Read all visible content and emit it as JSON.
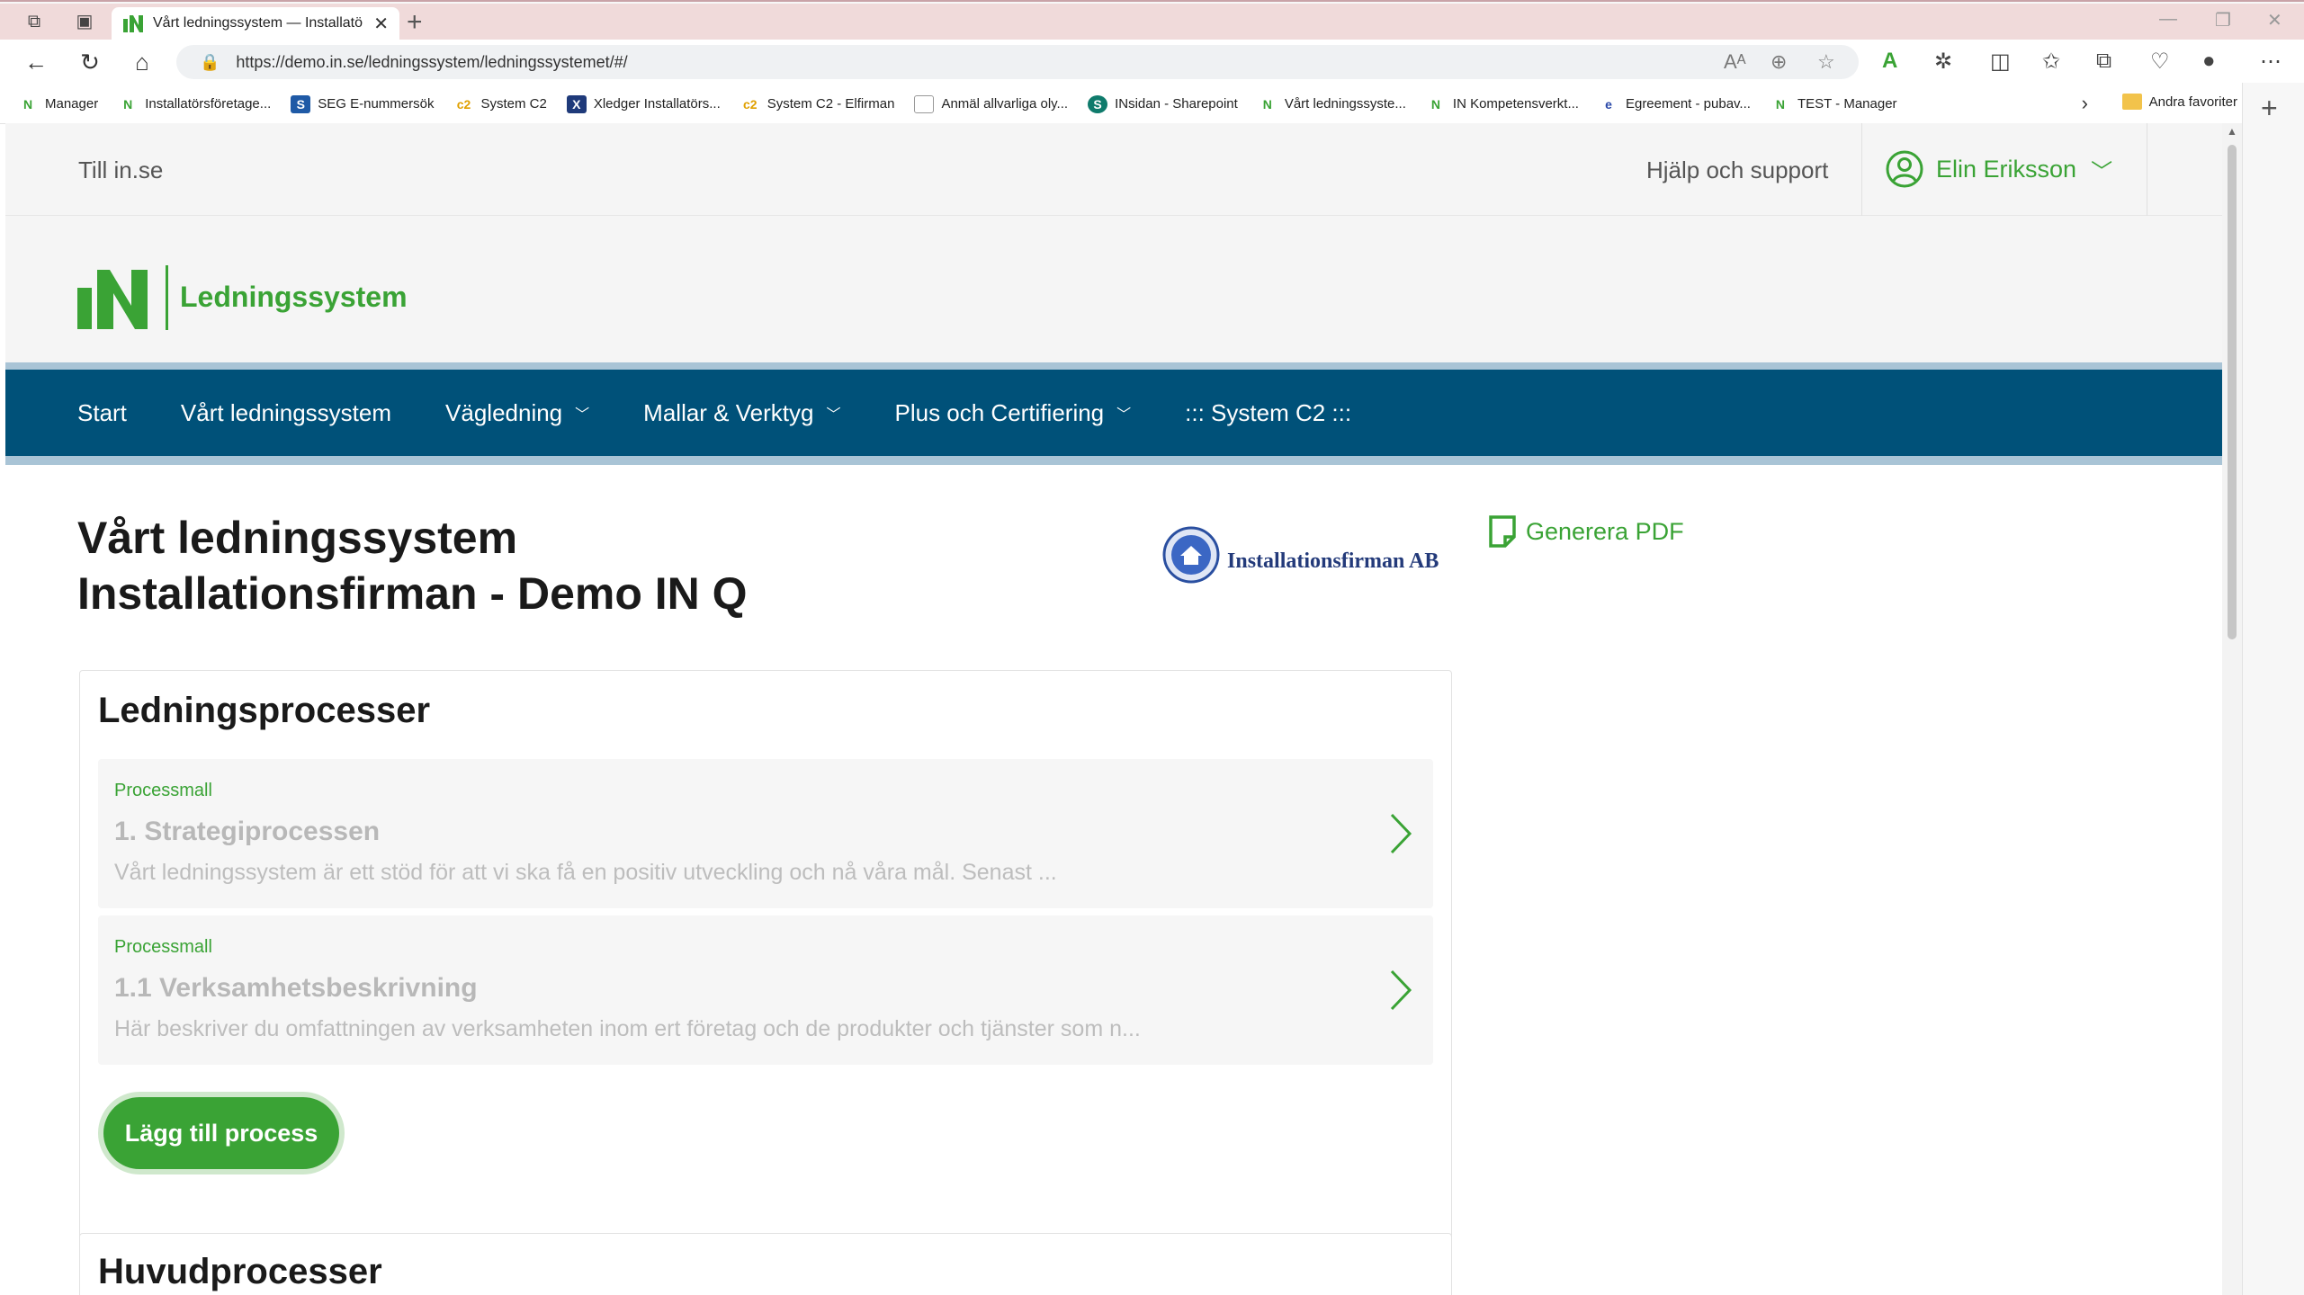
{
  "browser": {
    "tab_title": "Vårt ledningssystem — Installatö",
    "url": "https://demo.in.se/ledningssystem/ledningssystemet/#/",
    "favorites": [
      {
        "label": "Manager",
        "icon": "in"
      },
      {
        "label": "Installatörsföretage...",
        "icon": "in"
      },
      {
        "label": "SEG E-nummersök",
        "icon": "seg"
      },
      {
        "label": "System C2",
        "icon": "c2"
      },
      {
        "label": "Xledger  Installatörs...",
        "icon": "xl"
      },
      {
        "label": "System C2 - Elfirman",
        "icon": "c2"
      },
      {
        "label": "Anmäl allvarliga oly...",
        "icon": "doc"
      },
      {
        "label": "INsidan - Sharepoint",
        "icon": "sp"
      },
      {
        "label": "Vårt ledningssyste...",
        "icon": "in"
      },
      {
        "label": "IN Kompetensverkt...",
        "icon": "in"
      },
      {
        "label": "Egreement - pubav...",
        "icon": "eg"
      },
      {
        "label": "TEST - Manager",
        "icon": "in"
      }
    ],
    "other_favorites": "Andra favoriter"
  },
  "topbar": {
    "back_link": "Till in.se",
    "help": "Hjälp och support",
    "user_name": "Elin Eriksson"
  },
  "brand": {
    "name": "Ledningssystem",
    "color": "#3aa335"
  },
  "nav": {
    "items": [
      {
        "label": "Start",
        "dropdown": false
      },
      {
        "label": "Vårt ledningssystem",
        "dropdown": false
      },
      {
        "label": "Vägledning",
        "dropdown": true
      },
      {
        "label": "Mallar & Verktyg",
        "dropdown": true
      },
      {
        "label": "Plus och Certifiering",
        "dropdown": true
      },
      {
        "label": "::: System C2 :::",
        "dropdown": false
      }
    ],
    "background": "#005179"
  },
  "main": {
    "title_line1": "Vårt ledningssystem",
    "title_line2": "Installationsfirman - Demo IN Q",
    "company_name": "Installationsfirman AB",
    "generate_pdf": "Generera PDF"
  },
  "sections": [
    {
      "title": "Ledningsprocesser",
      "processes": [
        {
          "kind": "Processmall",
          "name": "1. Strategiprocessen",
          "desc": "Vårt ledningssystem är ett stöd för att vi ska få en positiv utveckling och nå våra mål. Senast ..."
        },
        {
          "kind": "Processmall",
          "name": "1.1 Verksamhetsbeskrivning",
          "desc": "Här beskriver du omfattningen av verksamheten inom ert företag och de produkter och tjänster som n..."
        }
      ],
      "add_button": "Lägg till process"
    },
    {
      "title": "Huvudprocesser"
    }
  ]
}
